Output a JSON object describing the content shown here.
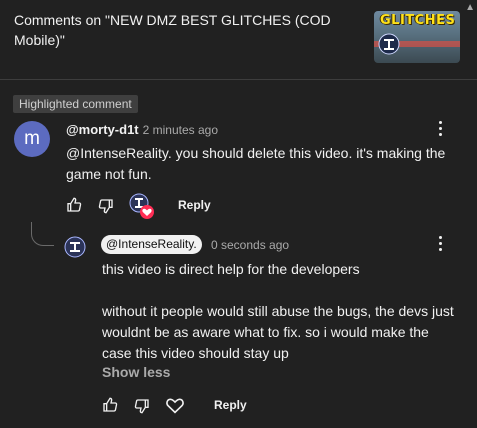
{
  "header": {
    "title": "Comments on \"NEW DMZ BEST GLITCHES (COD Mobile)\"",
    "thumbnail": {
      "title_text": "GLITCHES",
      "accent": "#ffe21a"
    }
  },
  "highlighted_label": "Highlighted comment",
  "comment": {
    "avatar_letter": "m",
    "avatar_color": "#5c6bc0",
    "author": "@morty-d1t",
    "time": "2 minutes ago",
    "text": "@IntenseReality. you should delete this video. it's making the game not fun.",
    "reply_label": "Reply"
  },
  "reply": {
    "author_chip": "@IntenseReality.",
    "time": "0 seconds ago",
    "paragraph1": "this video is direct help for the developers",
    "paragraph2": "without it people would still abuse the bugs, the devs just wouldnt be as aware what to fix. so i would make the case this video should stay up",
    "show_less": "Show less",
    "reply_label": "Reply"
  },
  "icons": [
    "like-icon",
    "dislike-icon",
    "heart-icon",
    "more-vert-icon",
    "scroll-up-icon"
  ],
  "colors": {
    "background": "#212121",
    "text": "#f1f1f1",
    "secondary": "#aaaaaa",
    "heart": "#ff2d55"
  }
}
